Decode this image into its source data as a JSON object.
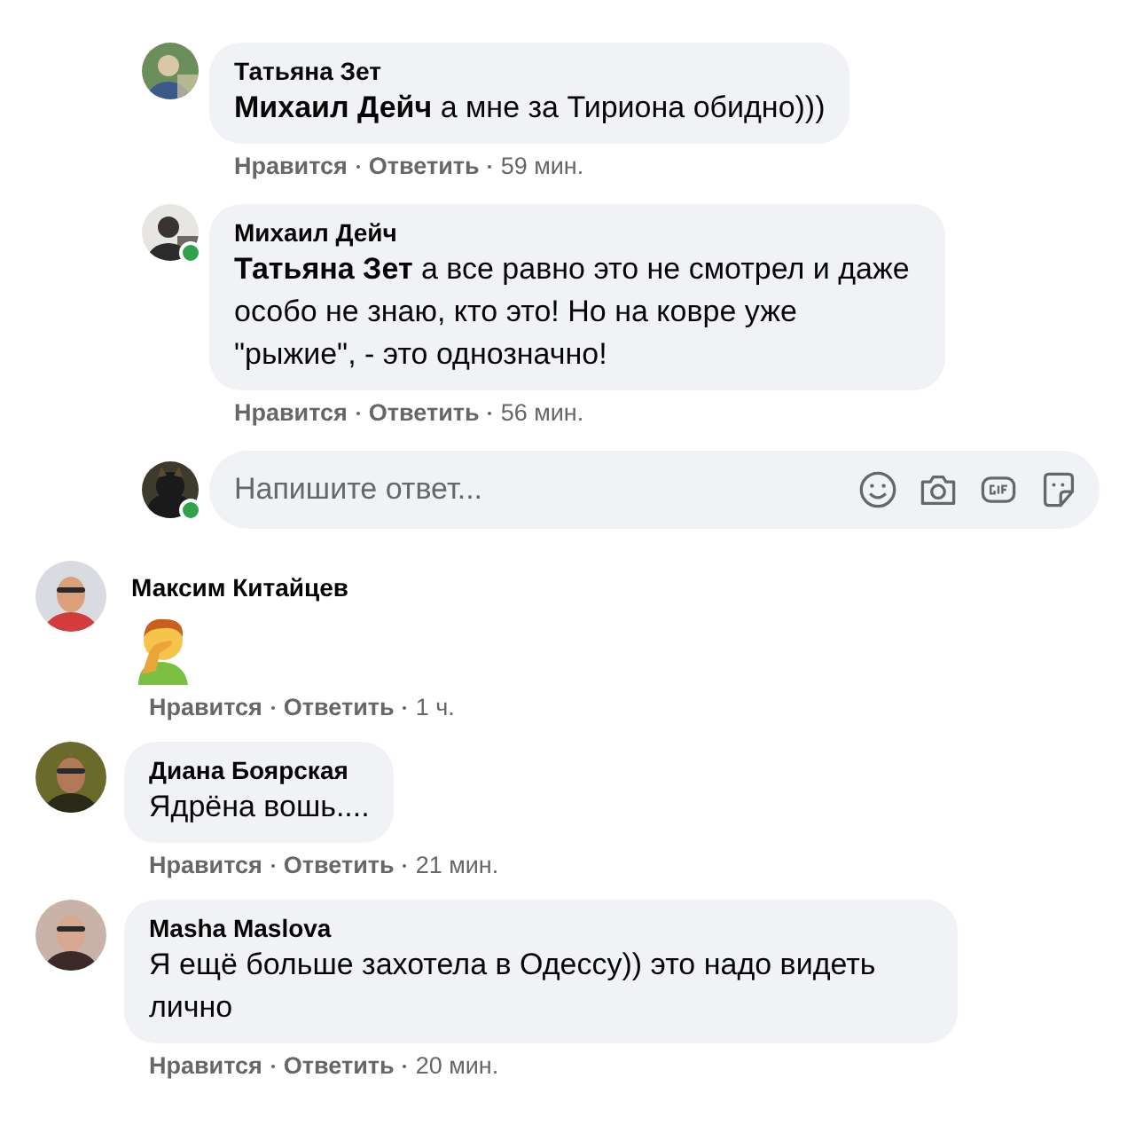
{
  "replies": [
    {
      "name": "Татьяна Зет",
      "text": "**Михаил Дейч** а мне за Тириона обидно)))",
      "online": false,
      "like": "Нравится",
      "reply": "Ответить",
      "time": "59 мин."
    },
    {
      "name": "Михаил Дейч",
      "text": "**Татьяна Зет** а все равно это не смотрел и даже особо не знаю, кто это! Но на ковре уже \"рыжие\", - это однозначно!",
      "online": true,
      "like": "Нравится",
      "reply": "Ответить",
      "time": "56 мин."
    }
  ],
  "reply_box": {
    "placeholder": "Напишите ответ...",
    "online": true
  },
  "comments": [
    {
      "kind": "emoji",
      "name": "Максим Китайцев",
      "like": "Нравится",
      "reply": "Ответить",
      "time": "1 ч."
    },
    {
      "kind": "text",
      "name": "Диана Боярская",
      "text": "Ядрёна вошь....",
      "like": "Нравится",
      "reply": "Ответить",
      "time": "21 мин."
    },
    {
      "kind": "text",
      "name": "Masha Maslova",
      "text": "Я ещё больше захотела в Одессу)) это надо видеть лично",
      "like": "Нравится",
      "reply": "Ответить",
      "time": "20 мин."
    }
  ]
}
